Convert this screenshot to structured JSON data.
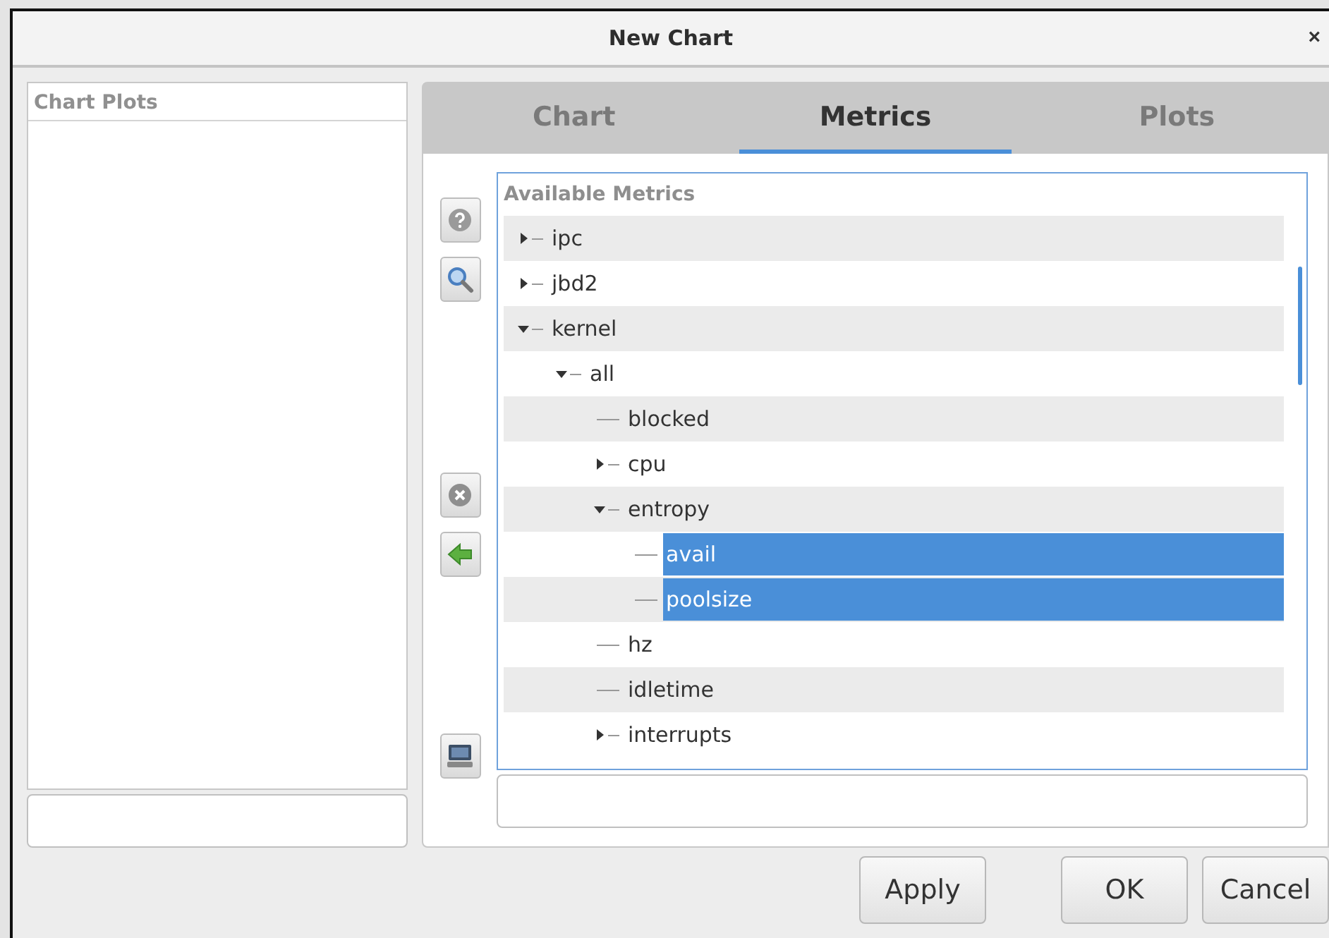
{
  "window": {
    "title": "New Chart",
    "close": "×"
  },
  "chart_plots": {
    "header": "Chart Plots"
  },
  "tabs": [
    {
      "label": "Chart",
      "selected": false
    },
    {
      "label": "Metrics",
      "selected": true
    },
    {
      "label": "Plots",
      "selected": false
    }
  ],
  "metrics_tree": {
    "header": "Available Metrics",
    "items": [
      {
        "label": "ipc",
        "kind": "branch",
        "expanded": false,
        "selected": false
      },
      {
        "label": "jbd2",
        "kind": "branch",
        "expanded": false,
        "selected": false
      },
      {
        "label": "kernel",
        "kind": "branch",
        "expanded": true,
        "selected": false,
        "children": [
          {
            "label": "all",
            "kind": "branch",
            "expanded": true,
            "selected": false,
            "children": [
              {
                "label": "blocked",
                "kind": "leaf",
                "selected": false
              },
              {
                "label": "cpu",
                "kind": "branch",
                "expanded": false,
                "selected": false
              },
              {
                "label": "entropy",
                "kind": "branch",
                "expanded": true,
                "selected": false,
                "children": [
                  {
                    "label": "avail",
                    "kind": "leaf",
                    "selected": true
                  },
                  {
                    "label": "poolsize",
                    "kind": "leaf",
                    "selected": true
                  }
                ]
              },
              {
                "label": "hz",
                "kind": "leaf",
                "selected": false
              },
              {
                "label": "idletime",
                "kind": "leaf",
                "selected": false
              },
              {
                "label": "interrupts",
                "kind": "branch",
                "expanded": false,
                "selected": false
              }
            ]
          }
        ]
      }
    ]
  },
  "buttons": [
    {
      "label": "Apply"
    },
    {
      "label": "OK"
    },
    {
      "label": "Cancel"
    }
  ]
}
